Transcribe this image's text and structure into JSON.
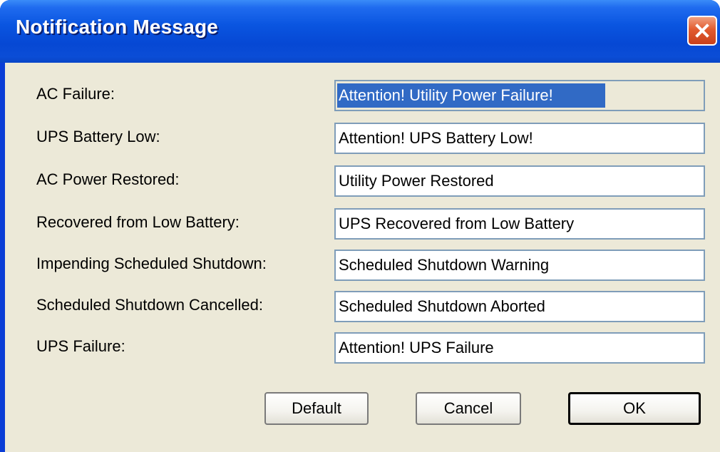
{
  "window": {
    "title": "Notification Message"
  },
  "fields": [
    {
      "label": "AC Failure:",
      "value": "Attention! Utility Power Failure!",
      "selected": true
    },
    {
      "label": "UPS Battery Low:",
      "value": "Attention! UPS Battery Low!"
    },
    {
      "label": "AC Power Restored:",
      "value": "Utility Power Restored"
    },
    {
      "label": "Recovered from Low Battery:",
      "value": "UPS Recovered from Low Battery"
    },
    {
      "label": "Impending Scheduled Shutdown:",
      "value": "Scheduled Shutdown Warning"
    },
    {
      "label": "Scheduled Shutdown Cancelled:",
      "value": "Scheduled Shutdown Aborted"
    },
    {
      "label": "UPS Failure:",
      "value": "Attention! UPS Failure"
    }
  ],
  "buttons": {
    "default_label": "Default",
    "cancel_label": "Cancel",
    "ok_label": "OK"
  },
  "colors": {
    "titlebar": "#0A55E0",
    "client": "#ECE9D8",
    "selection": "#316AC5",
    "close": "#E25B2F"
  },
  "icons": {
    "close": "close-icon"
  }
}
